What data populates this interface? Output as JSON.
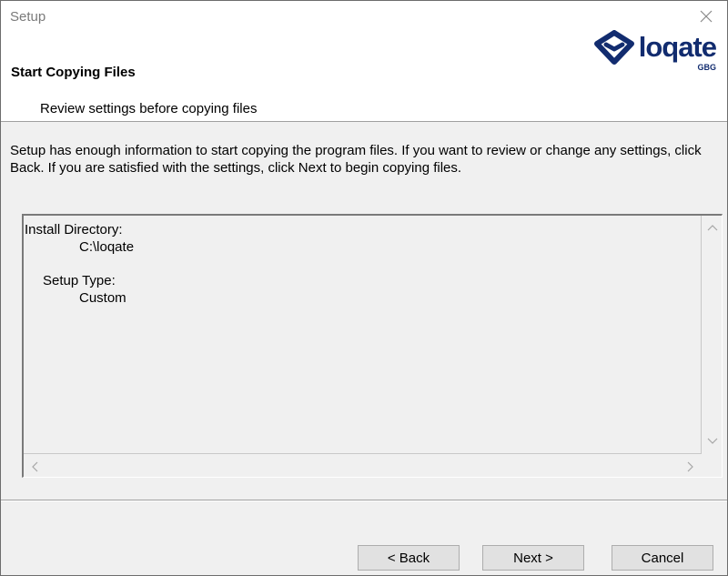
{
  "window": {
    "title": "Setup",
    "close_symbol": "×"
  },
  "header": {
    "title": "Start Copying Files",
    "subtitle": "Review settings before copying files",
    "logo": {
      "icon": "loqate-pin-icon",
      "word": "loqate",
      "sub": "GBG",
      "color": "#122c6f"
    }
  },
  "body": {
    "description": "Setup has enough information to start copying the program files.  If you want to review or change any settings, click Back.  If you are satisfied with the settings, click Next to begin copying files.",
    "summary": {
      "install_dir_label": "Install Directory:",
      "install_dir_value": "C:\\loqate",
      "setup_type_label": "Setup Type:",
      "setup_type_value": "Custom"
    }
  },
  "buttons": {
    "back": "< Back",
    "next": "Next >",
    "cancel": "Cancel"
  }
}
